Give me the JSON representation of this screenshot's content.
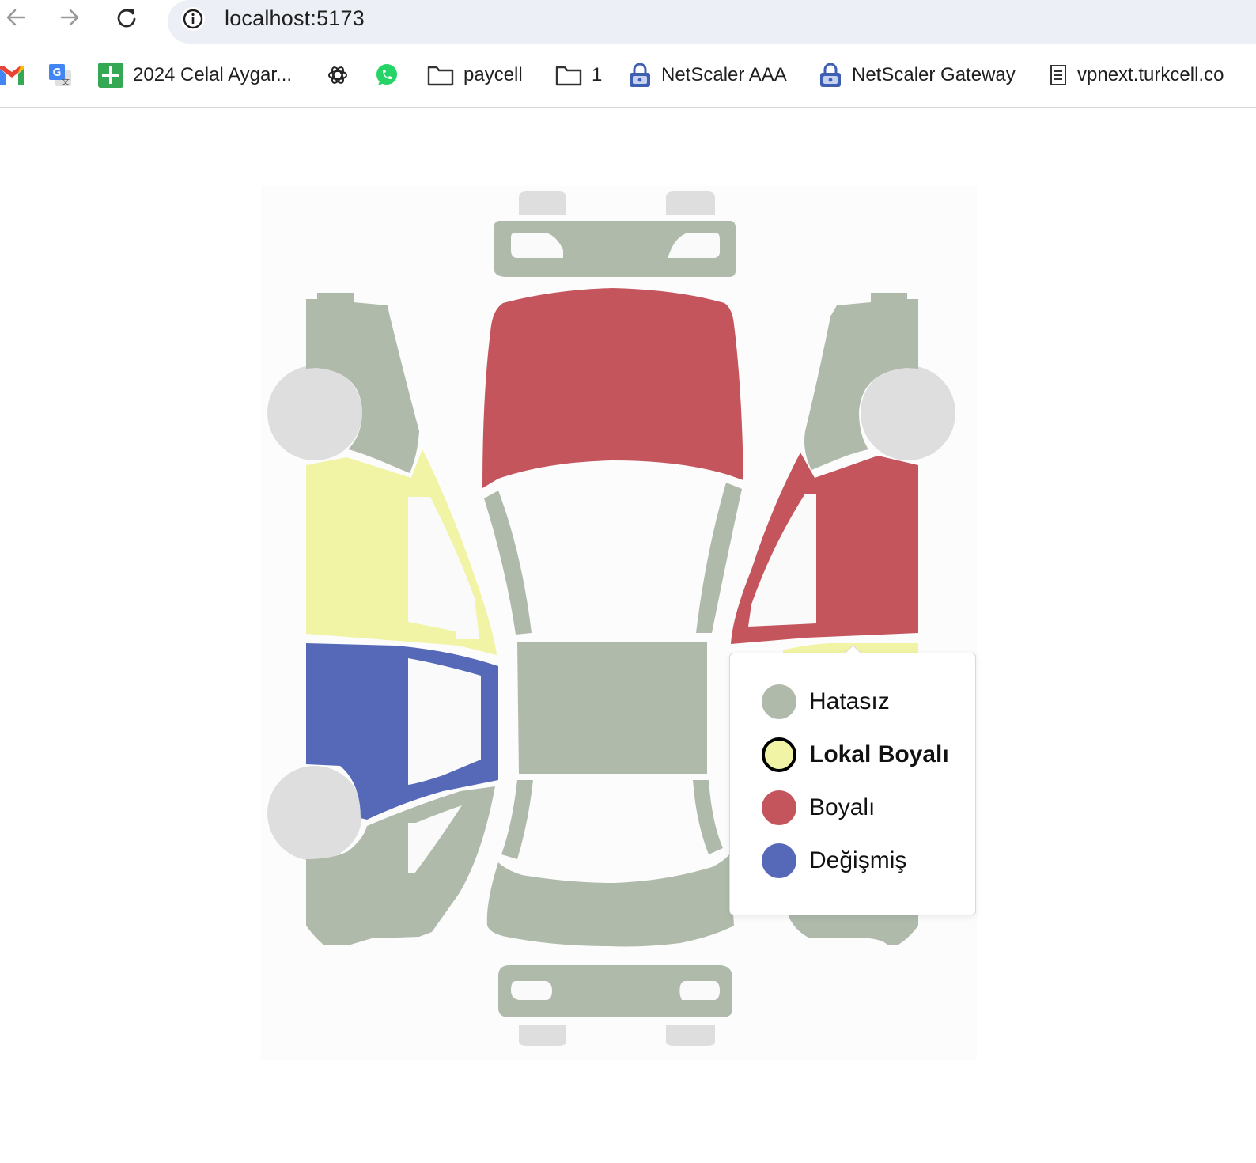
{
  "browser": {
    "url": "localhost:5173",
    "bookmarks": [
      {
        "label": "",
        "icon": "gmail-icon"
      },
      {
        "label": "",
        "icon": "google-translate-icon"
      },
      {
        "label": "2024 Celal Aygar...",
        "icon": "google-sheets-icon"
      },
      {
        "label": "",
        "icon": "openai-icon"
      },
      {
        "label": "",
        "icon": "whatsapp-icon"
      },
      {
        "label": "paycell",
        "icon": "folder-icon"
      },
      {
        "label": "1",
        "icon": "folder-icon"
      },
      {
        "label": "NetScaler AAA",
        "icon": "lock-icon"
      },
      {
        "label": "NetScaler Gateway",
        "icon": "lock-icon"
      },
      {
        "label": "vpnext.turkcell.co",
        "icon": "page-icon"
      }
    ]
  },
  "colors": {
    "hatasiz": "#afbaab",
    "lokal_boyali": "#f1f3a5",
    "boyali": "#c4555d",
    "degismis": "#5669b8",
    "wheel": "#dedede",
    "glass": "#fafafa"
  },
  "car_parts": [
    {
      "name": "front-bumper",
      "status": "hatasiz"
    },
    {
      "name": "hood",
      "status": "boyali"
    },
    {
      "name": "left-front-fender",
      "status": "hatasiz"
    },
    {
      "name": "right-front-fender",
      "status": "hatasiz"
    },
    {
      "name": "left-front-door",
      "status": "lokal_boyali"
    },
    {
      "name": "left-rear-door",
      "status": "degismis"
    },
    {
      "name": "right-front-door",
      "status": "boyali"
    },
    {
      "name": "right-rear-door",
      "status": "lokal_boyali"
    },
    {
      "name": "roof",
      "status": "hatasiz"
    },
    {
      "name": "left-a-pillar",
      "status": "hatasiz"
    },
    {
      "name": "right-a-pillar",
      "status": "hatasiz"
    },
    {
      "name": "left-c-pillar",
      "status": "hatasiz"
    },
    {
      "name": "right-c-pillar",
      "status": "hatasiz"
    },
    {
      "name": "left-rear-fender",
      "status": "hatasiz"
    },
    {
      "name": "right-rear-fender",
      "status": "hatasiz"
    },
    {
      "name": "trunk",
      "status": "hatasiz"
    },
    {
      "name": "rear-bumper",
      "status": "hatasiz"
    }
  ],
  "legend": {
    "items": [
      {
        "label": "Hatasız",
        "key": "hatasiz",
        "selected": false
      },
      {
        "label": "Lokal Boyalı",
        "key": "lokal_boyali",
        "selected": true
      },
      {
        "label": "Boyalı",
        "key": "boyali",
        "selected": false
      },
      {
        "label": "Değişmiş",
        "key": "degismis",
        "selected": false
      }
    ]
  }
}
